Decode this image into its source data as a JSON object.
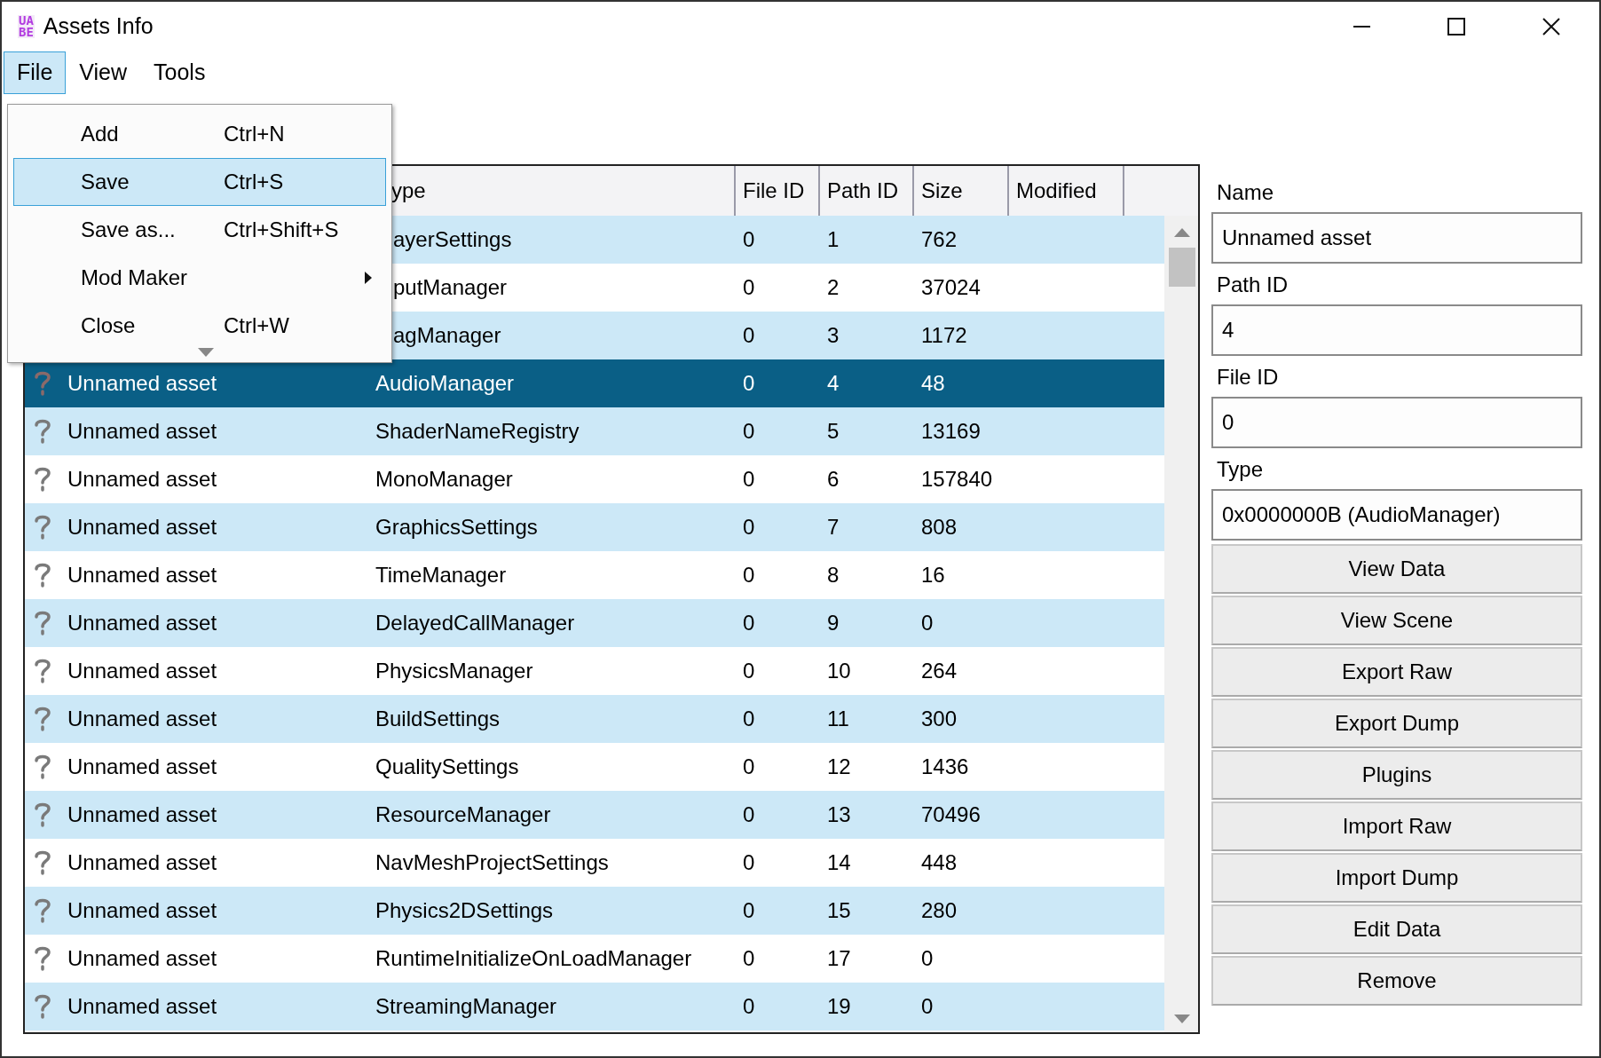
{
  "window": {
    "title": "Assets Info",
    "logo_lines": [
      "UA",
      "BE"
    ]
  },
  "menu_bar": [
    {
      "label": "File",
      "selected": true
    },
    {
      "label": "View",
      "selected": false
    },
    {
      "label": "Tools",
      "selected": false
    }
  ],
  "file_menu": {
    "items": [
      {
        "kind": "command",
        "label": "Add",
        "shortcut": "Ctrl+N",
        "selected": false
      },
      {
        "kind": "command",
        "label": "Save",
        "shortcut": "Ctrl+S",
        "selected": true
      },
      {
        "kind": "command",
        "label": "Save as...",
        "shortcut": "Ctrl+Shift+S",
        "selected": false
      },
      {
        "kind": "submenu",
        "label": "Mod Maker",
        "selected": false
      },
      {
        "kind": "command",
        "label": "Close",
        "shortcut": "Ctrl+W",
        "selected": false
      }
    ]
  },
  "table": {
    "columns": [
      "ype",
      "File ID",
      "Path ID",
      "Size",
      "Modified"
    ],
    "rows": [
      {
        "type": "ayerSettings",
        "file_id": "0",
        "path_id": "1",
        "size": "762",
        "selected": false
      },
      {
        "type": "putManager",
        "file_id": "0",
        "path_id": "2",
        "size": "37024",
        "selected": false
      },
      {
        "type": "agManager",
        "file_id": "0",
        "path_id": "3",
        "size": "1172",
        "selected": false
      },
      {
        "name": "Unnamed asset",
        "type": "AudioManager",
        "file_id": "0",
        "path_id": "4",
        "size": "48",
        "selected": true
      },
      {
        "name": "Unnamed asset",
        "type": "ShaderNameRegistry",
        "file_id": "0",
        "path_id": "5",
        "size": "13169",
        "selected": false
      },
      {
        "name": "Unnamed asset",
        "type": "MonoManager",
        "file_id": "0",
        "path_id": "6",
        "size": "157840",
        "selected": false
      },
      {
        "name": "Unnamed asset",
        "type": "GraphicsSettings",
        "file_id": "0",
        "path_id": "7",
        "size": "808",
        "selected": false
      },
      {
        "name": "Unnamed asset",
        "type": "TimeManager",
        "file_id": "0",
        "path_id": "8",
        "size": "16",
        "selected": false
      },
      {
        "name": "Unnamed asset",
        "type": "DelayedCallManager",
        "file_id": "0",
        "path_id": "9",
        "size": "0",
        "selected": false
      },
      {
        "name": "Unnamed asset",
        "type": "PhysicsManager",
        "file_id": "0",
        "path_id": "10",
        "size": "264",
        "selected": false
      },
      {
        "name": "Unnamed asset",
        "type": "BuildSettings",
        "file_id": "0",
        "path_id": "11",
        "size": "300",
        "selected": false
      },
      {
        "name": "Unnamed asset",
        "type": "QualitySettings",
        "file_id": "0",
        "path_id": "12",
        "size": "1436",
        "selected": false
      },
      {
        "name": "Unnamed asset",
        "type": "ResourceManager",
        "file_id": "0",
        "path_id": "13",
        "size": "70496",
        "selected": false
      },
      {
        "name": "Unnamed asset",
        "type": "NavMeshProjectSettings",
        "file_id": "0",
        "path_id": "14",
        "size": "448",
        "selected": false
      },
      {
        "name": "Unnamed asset",
        "type": "Physics2DSettings",
        "file_id": "0",
        "path_id": "15",
        "size": "280",
        "selected": false
      },
      {
        "name": "Unnamed asset",
        "type": "RuntimeInitializeOnLoadManager",
        "file_id": "0",
        "path_id": "17",
        "size": "0",
        "selected": false
      },
      {
        "name": "Unnamed asset",
        "type": "StreamingManager",
        "file_id": "0",
        "path_id": "19",
        "size": "0",
        "selected": false
      }
    ]
  },
  "details": {
    "fields": [
      {
        "label": "Name",
        "value": "Unnamed asset"
      },
      {
        "label": "Path ID",
        "value": "4"
      },
      {
        "label": "File ID",
        "value": "0"
      },
      {
        "label": "Type",
        "value": "0x0000000B (AudioManager)"
      }
    ],
    "buttons": [
      "View Data",
      "View Scene",
      "Export Raw",
      "Export Dump",
      "Plugins",
      "Import Raw",
      "Import Dump",
      "Edit Data",
      "Remove"
    ]
  }
}
